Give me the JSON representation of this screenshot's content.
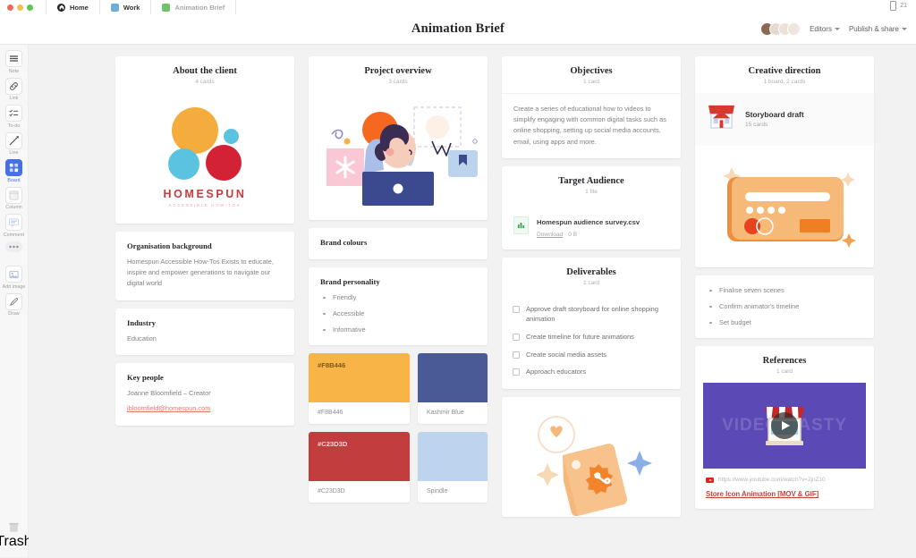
{
  "window": {
    "tabs": [
      {
        "label": "Home",
        "icon": "home-icon"
      },
      {
        "label": "Work",
        "icon": "work-swatch-icon"
      },
      {
        "label": "Animation Brief",
        "icon": "board-swatch-icon"
      }
    ],
    "doc_count": "21"
  },
  "header": {
    "title": "Animation Brief",
    "editors_label": "Editors",
    "publish_label": "Publish & share"
  },
  "toolbar": {
    "items": [
      {
        "label": "Note",
        "icon": "note-icon"
      },
      {
        "label": "Link",
        "icon": "link-icon"
      },
      {
        "label": "To-do",
        "icon": "todo-icon"
      },
      {
        "label": "Line",
        "icon": "line-icon"
      },
      {
        "label": "Board",
        "icon": "board-icon"
      },
      {
        "label": "Column",
        "icon": "column-icon"
      },
      {
        "label": "Comment",
        "icon": "comment-icon"
      },
      {
        "label": "",
        "icon": "more-icon"
      },
      {
        "label": "Add image",
        "icon": "add-image-icon"
      },
      {
        "label": "Draw",
        "icon": "draw-icon"
      }
    ],
    "trash_label": "Trash"
  },
  "columns": [
    {
      "title": "About the client",
      "subtitle": "4 cards",
      "logo": {
        "name": "HOMESPUN",
        "tagline": "ACCESSIBLE HOW-TOS"
      },
      "sections": [
        {
          "heading": "Organisation background",
          "text": "Homespun Accessible How-Tos Exists to educate, inspire and empower generations to navigate our digital world"
        },
        {
          "heading": "Industry",
          "text": "Education"
        },
        {
          "heading": "Key people",
          "text": "Joanne Bloomfield – Creator",
          "email": "jbloomfield@homespun.com"
        }
      ]
    },
    {
      "title": "Project overview",
      "subtitle": "3 cards",
      "brand_colours_heading": "Brand colours",
      "brand_personality_heading": "Brand personality",
      "personality": [
        "Friendly",
        "Accessible",
        "Informative"
      ],
      "swatches": [
        {
          "label": "#F8B446",
          "name": "#F8B446",
          "hex": "#F8B446",
          "text_color": "#7a5a18",
          "wide": true
        },
        {
          "label": "",
          "name": "Kashmir Blue",
          "hex": "#495A96",
          "text_color": "#ffffff",
          "wide": false
        },
        {
          "label": "#C23D3D",
          "name": "#C23D3D",
          "hex": "#C23D3D",
          "text_color": "#ffd6d6",
          "wide": true
        },
        {
          "label": "",
          "name": "Spindle",
          "hex": "#BDD4EE",
          "text_color": "#3c4a5c",
          "wide": false
        }
      ]
    },
    {
      "title": "Objectives",
      "subtitle": "1 card",
      "objective_text": "Create a series of educational how to videos to simplify engaging with common digital tasks such as online shopping, setting up social media accounts, email, using apps and more.",
      "audience": {
        "title": "Target Audience",
        "subtitle": "1 file",
        "file_name": "Homespun audience survey.csv",
        "download_label": "Download",
        "file_size": "0 B"
      },
      "deliverables": {
        "title": "Deliverables",
        "subtitle": "1 card",
        "items": [
          "Approve draft storyboard for online shopping animation",
          "Create timeline for future animations",
          "Create social media assets",
          "Approach educators"
        ]
      }
    },
    {
      "title": "Creative direction",
      "subtitle": "1 board, 2 cards",
      "board": {
        "name": "Storyboard draft",
        "meta": "15 cards"
      },
      "bullets": [
        "Finalise seven scenes",
        "Confirm animator's timeline",
        "Set budget"
      ],
      "references": {
        "title": "References",
        "subtitle": "1 card",
        "watermark": "VIDEO NASTY",
        "url": "https://www.youtube.com/watch?v=2jnZ10",
        "link_title": "Store Icon Animation [MOV & GIF]"
      }
    }
  ],
  "colors": {
    "accent": "#4670e4",
    "brand_red": "#c23d3d",
    "brand_yellow": "#f8b446",
    "brand_blue": "#495a96",
    "link_red": "#c9403a"
  }
}
